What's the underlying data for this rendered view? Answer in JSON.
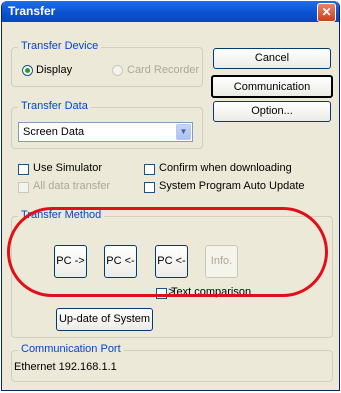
{
  "window": {
    "title": "Transfer",
    "close_symbol": "✕"
  },
  "transfer_device": {
    "label": "Transfer Device",
    "options": [
      {
        "label": "Display",
        "selected": true,
        "enabled": true
      },
      {
        "label": "Card Recorder",
        "selected": false,
        "enabled": false
      }
    ]
  },
  "transfer_data": {
    "label": "Transfer Data",
    "selected": "Screen Data"
  },
  "buttons": {
    "cancel": "Cancel",
    "communication_setting": "Communication Setting...",
    "option": "Option..."
  },
  "checkboxes": {
    "use_simulator": "Use Simulator",
    "confirm_when_downloading": "Confirm when downloading",
    "all_data_transfer": "All data transfer",
    "system_program_auto_update": "System Program Auto Update"
  },
  "transfer_method": {
    "label": "Transfer Method",
    "buttons": [
      "PC ->",
      "PC <-",
      "PC <->",
      "Info."
    ],
    "text_comparison": "Text comparison",
    "update_system": "Up-date of System"
  },
  "communication_port": {
    "label": "Communication Port",
    "value": "Ethernet 192.168.1.1"
  },
  "colors": {
    "title_bar": "#0a50d0",
    "group_label": "#0046d5",
    "highlight": "#e0101a"
  }
}
